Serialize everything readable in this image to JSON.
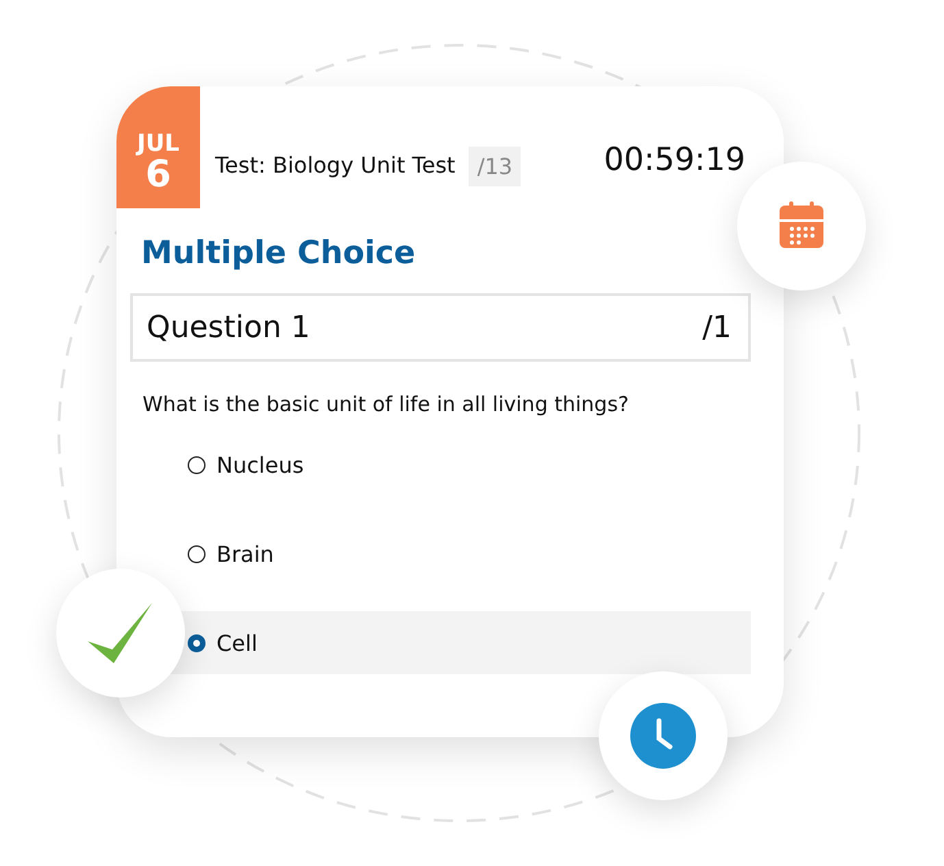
{
  "date": {
    "month": "JUL",
    "day": "6"
  },
  "test": {
    "title": "Test: Biology Unit Test",
    "total": "/13",
    "timer": "00:59:19"
  },
  "section": "Multiple Choice",
  "question": {
    "label": "Question 1",
    "points": "/1",
    "prompt": "What is the basic unit of life in all living things?"
  },
  "options": [
    {
      "label": "Nucleus",
      "selected": false
    },
    {
      "label": "Brain",
      "selected": false
    },
    {
      "label": "Cell",
      "selected": true
    }
  ]
}
